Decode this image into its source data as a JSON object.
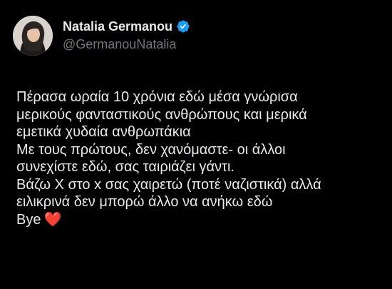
{
  "author": {
    "display_name": "Natalia Germanou",
    "handle": "@GermanouNatalia",
    "verified_icon": "verified-badge-icon",
    "verified_color": "#1d9bf0"
  },
  "tweet": {
    "lines": [
      "Πέρασα ωραία 10 χρόνια εδώ μέσα γνώρισα",
      "μερικούς φανταστικούς ανθρώπους και μερικά",
      "εμετικά χυδαία ανθρωπάκια",
      "Με τους πρώτους, δεν χανόμαστε- οι άλλοι",
      "συνεχίστε εδώ, σας ταιριάζει γάντι.",
      "Βάζω Χ στο x σας χαιρετώ (ποτέ ναζιστικά) αλλά",
      "ειλικρινά δεν μπορώ άλλο να ανήκω εδώ",
      "Bye"
    ],
    "emoji": "❤️",
    "emoji_icon": "red-heart-icon"
  },
  "colors": {
    "background": "#000000",
    "text": "#e7e9ea",
    "secondary_text": "#71767b",
    "heart": "#e0245e"
  }
}
